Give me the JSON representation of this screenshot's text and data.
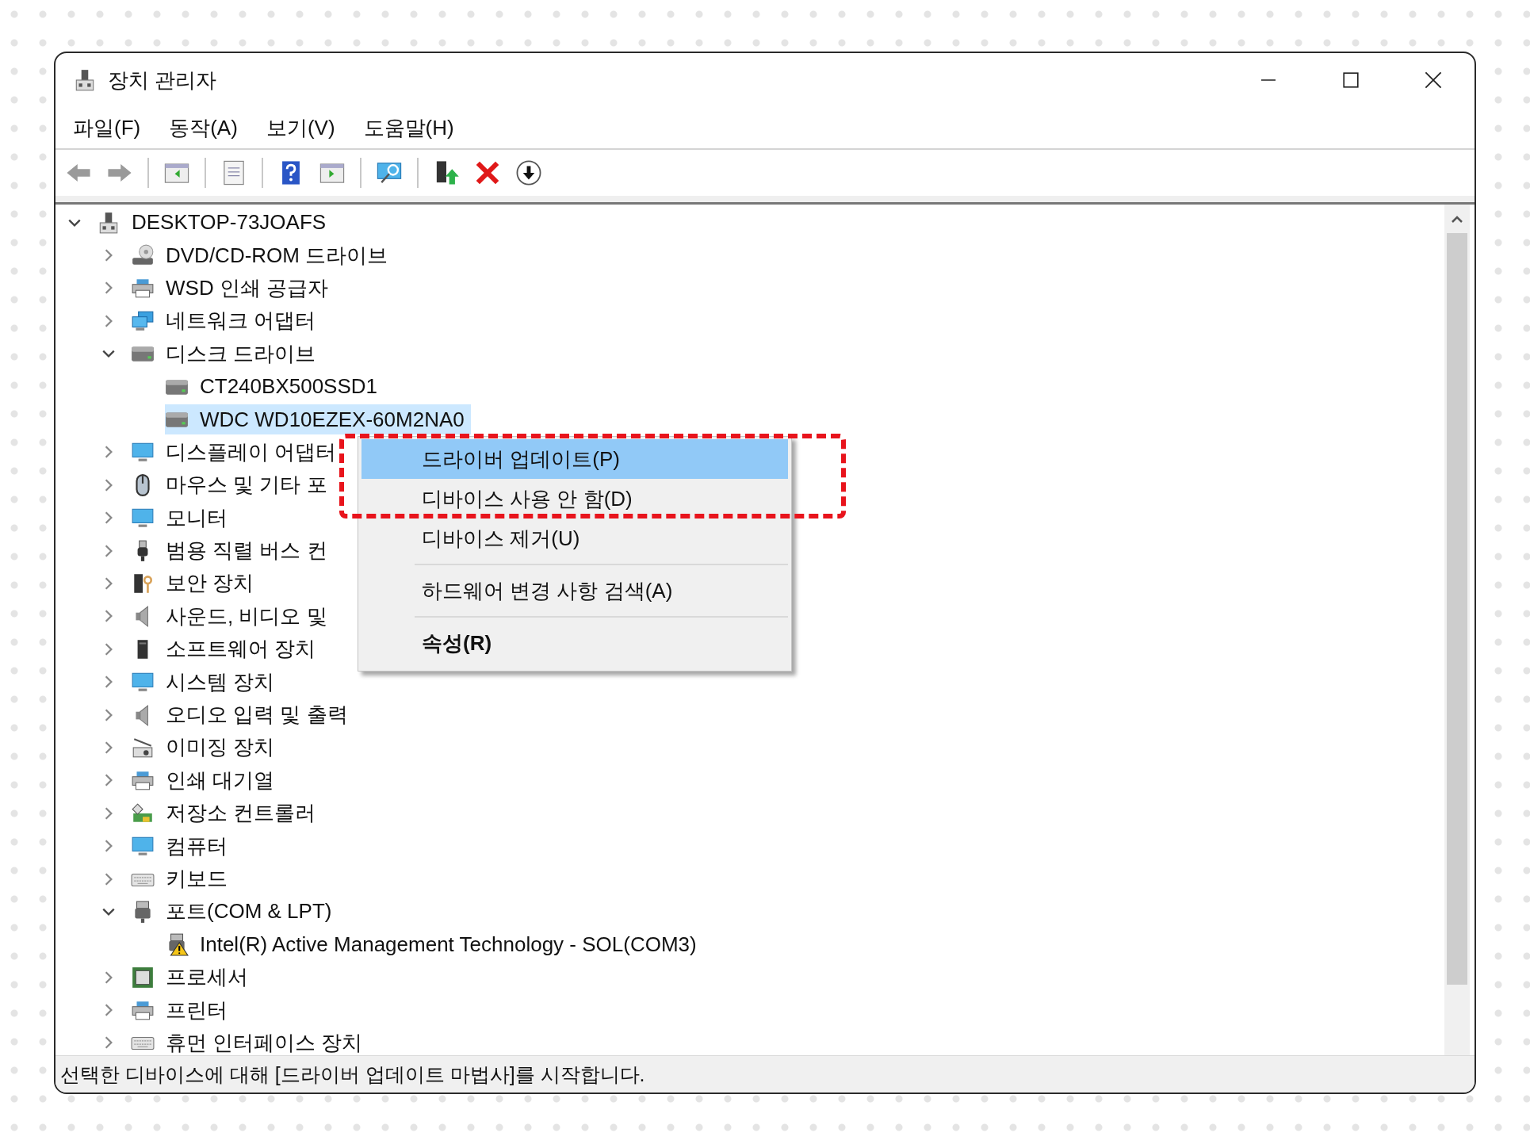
{
  "window": {
    "title": "장치 관리자"
  },
  "menubar": [
    "파일(F)",
    "동작(A)",
    "보기(V)",
    "도움말(H)"
  ],
  "tree": {
    "items": [
      {
        "label": "DESKTOP-73JOAFS",
        "expanded": true,
        "selected": false,
        "children": [
          {
            "label": "DVD/CD-ROM 드라이브",
            "expanded": false,
            "selected": false
          },
          {
            "label": "WSD 인쇄 공급자",
            "expanded": false,
            "selected": false
          },
          {
            "label": "네트워크 어댑터",
            "expanded": false,
            "selected": false
          },
          {
            "label": "디스크 드라이브",
            "expanded": true,
            "selected": false,
            "children": [
              {
                "label": "CT240BX500SSD1",
                "selected": false
              },
              {
                "label": "WDC WD10EZEX-60M2NA0",
                "selected": true
              }
            ]
          },
          {
            "label": "디스플레이 어댑터",
            "expanded": false,
            "selected": false
          },
          {
            "label": "마우스 및 기타 포",
            "expanded": false,
            "selected": false
          },
          {
            "label": "모니터",
            "expanded": false,
            "selected": false
          },
          {
            "label": "범용 직렬 버스 컨",
            "expanded": false,
            "selected": false
          },
          {
            "label": "보안 장치",
            "expanded": false,
            "selected": false
          },
          {
            "label": "사운드, 비디오 및",
            "expanded": false,
            "selected": false
          },
          {
            "label": "소프트웨어 장치",
            "expanded": false,
            "selected": false
          },
          {
            "label": "시스템 장치",
            "expanded": false,
            "selected": false
          },
          {
            "label": "오디오 입력 및 출력",
            "expanded": false,
            "selected": false
          },
          {
            "label": "이미징 장치",
            "expanded": false,
            "selected": false
          },
          {
            "label": "인쇄 대기열",
            "expanded": false,
            "selected": false
          },
          {
            "label": "저장소 컨트롤러",
            "expanded": false,
            "selected": false
          },
          {
            "label": "컴퓨터",
            "expanded": false,
            "selected": false
          },
          {
            "label": "키보드",
            "expanded": false,
            "selected": false
          },
          {
            "label": "포트(COM & LPT)",
            "expanded": true,
            "selected": false,
            "children": [
              {
                "label": "Intel(R) Active Management Technology - SOL(COM3)",
                "selected": false,
                "warning": true
              }
            ]
          },
          {
            "label": "프로세서",
            "expanded": false,
            "selected": false
          },
          {
            "label": "프린터",
            "expanded": false,
            "selected": false
          },
          {
            "label": "휴먼 인터페이스 장치",
            "expanded": false,
            "selected": false
          }
        ]
      }
    ]
  },
  "context_menu": {
    "items": [
      {
        "kind": "command",
        "label": "드라이버 업데이트(P)",
        "selected": true,
        "default": false
      },
      {
        "kind": "command",
        "label": "디바이스 사용 안 함(D)",
        "selected": false,
        "default": false
      },
      {
        "kind": "command",
        "label": "디바이스 제거(U)",
        "selected": false,
        "default": false
      },
      {
        "kind": "separator"
      },
      {
        "kind": "command",
        "label": "하드웨어 변경 사항 검색(A)",
        "selected": false,
        "default": false
      },
      {
        "kind": "separator"
      },
      {
        "kind": "command",
        "label": "속성(R)",
        "selected": false,
        "default": true
      }
    ]
  },
  "annotation": {
    "kind": "dashed_box"
  },
  "status_bar": {
    "text": "선택한 디바이스에 대해 [드라이버 업데이트 마법사]를 시작합니다."
  }
}
